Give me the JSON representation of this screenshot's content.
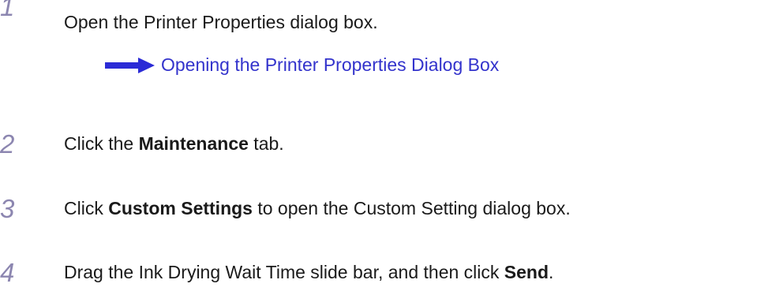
{
  "steps": [
    {
      "number": "1",
      "text": "Open the Printer Properties dialog box."
    },
    {
      "number": "2",
      "prefix": "Click the ",
      "bold": "Maintenance",
      "suffix": " tab."
    },
    {
      "number": "3",
      "prefix": "Click ",
      "bold": "Custom Settings",
      "suffix": " to open the Custom Setting dialog box."
    },
    {
      "number": "4",
      "prefix": "Drag the Ink Drying Wait Time slide bar, and then click ",
      "bold": "Send",
      "suffix": "."
    }
  ],
  "link": {
    "text": "Opening the Printer Properties Dialog Box",
    "icon": "right-arrow-icon"
  },
  "colors": {
    "step_number": "#8c86b0",
    "link": "#3333cc",
    "arrow": "#2b2bd6",
    "text": "#1a1a1a"
  }
}
